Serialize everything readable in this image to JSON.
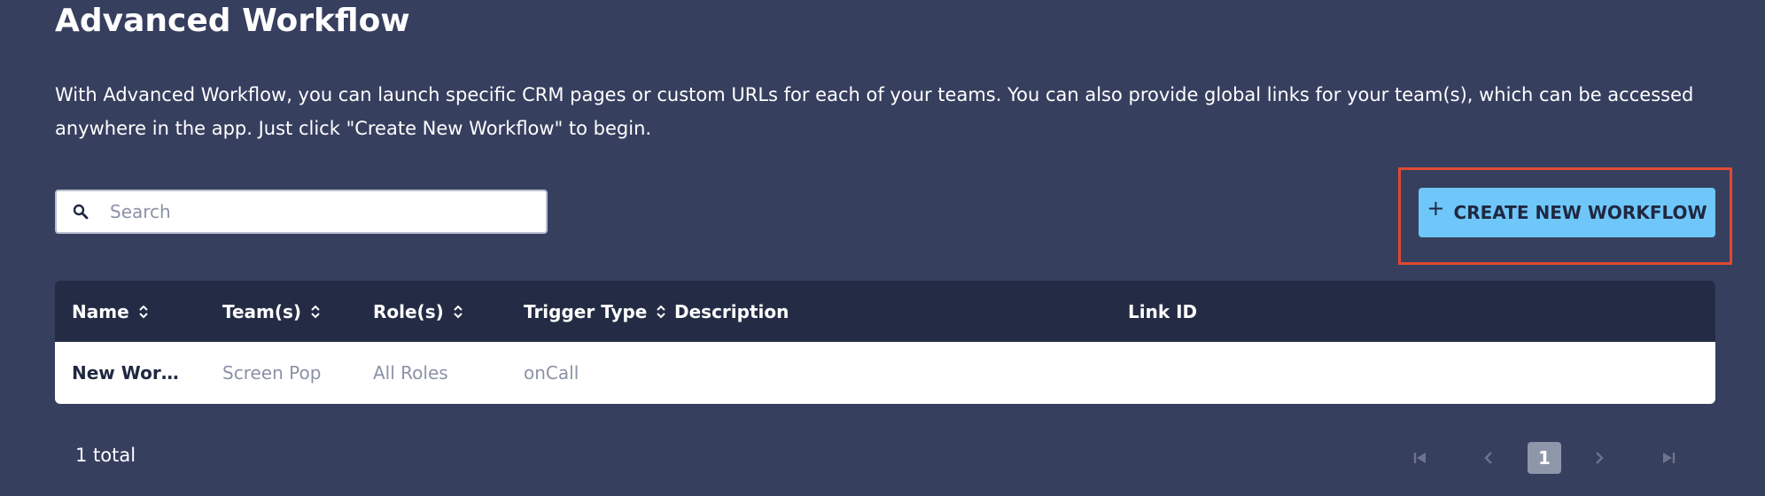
{
  "page": {
    "title": "Advanced Workflow",
    "description": "With Advanced Workflow, you can launch specific CRM pages or custom URLs for each of your teams. You can also provide global links for your team(s), which can be accessed anywhere in the app. Just click \"Create New Workflow\" to begin."
  },
  "search": {
    "placeholder": "Search",
    "value": "",
    "icon": "search-icon"
  },
  "toolbar": {
    "create_label": "CREATE NEW WORKFLOW",
    "create_icon": "plus-icon"
  },
  "table": {
    "columns": [
      {
        "label": "Name",
        "sortable": true
      },
      {
        "label": "Team(s)",
        "sortable": true
      },
      {
        "label": "Role(s)",
        "sortable": true
      },
      {
        "label": "Trigger Type",
        "sortable": true
      },
      {
        "label": "Description",
        "sortable": false
      },
      {
        "label": "Link ID",
        "sortable": false
      }
    ],
    "rows": [
      {
        "name": "New Workflow",
        "teams": "Screen Pop",
        "roles": "All Roles",
        "trigger_type": "onCall",
        "description": "",
        "link_id": ""
      }
    ]
  },
  "footer": {
    "total": "1 total"
  },
  "pagination": {
    "current_page": "1"
  },
  "colors": {
    "background": "#373f5f",
    "table_header": "#242c45",
    "accent_button": "#6fc6f9",
    "highlight": "#e04a2f"
  }
}
